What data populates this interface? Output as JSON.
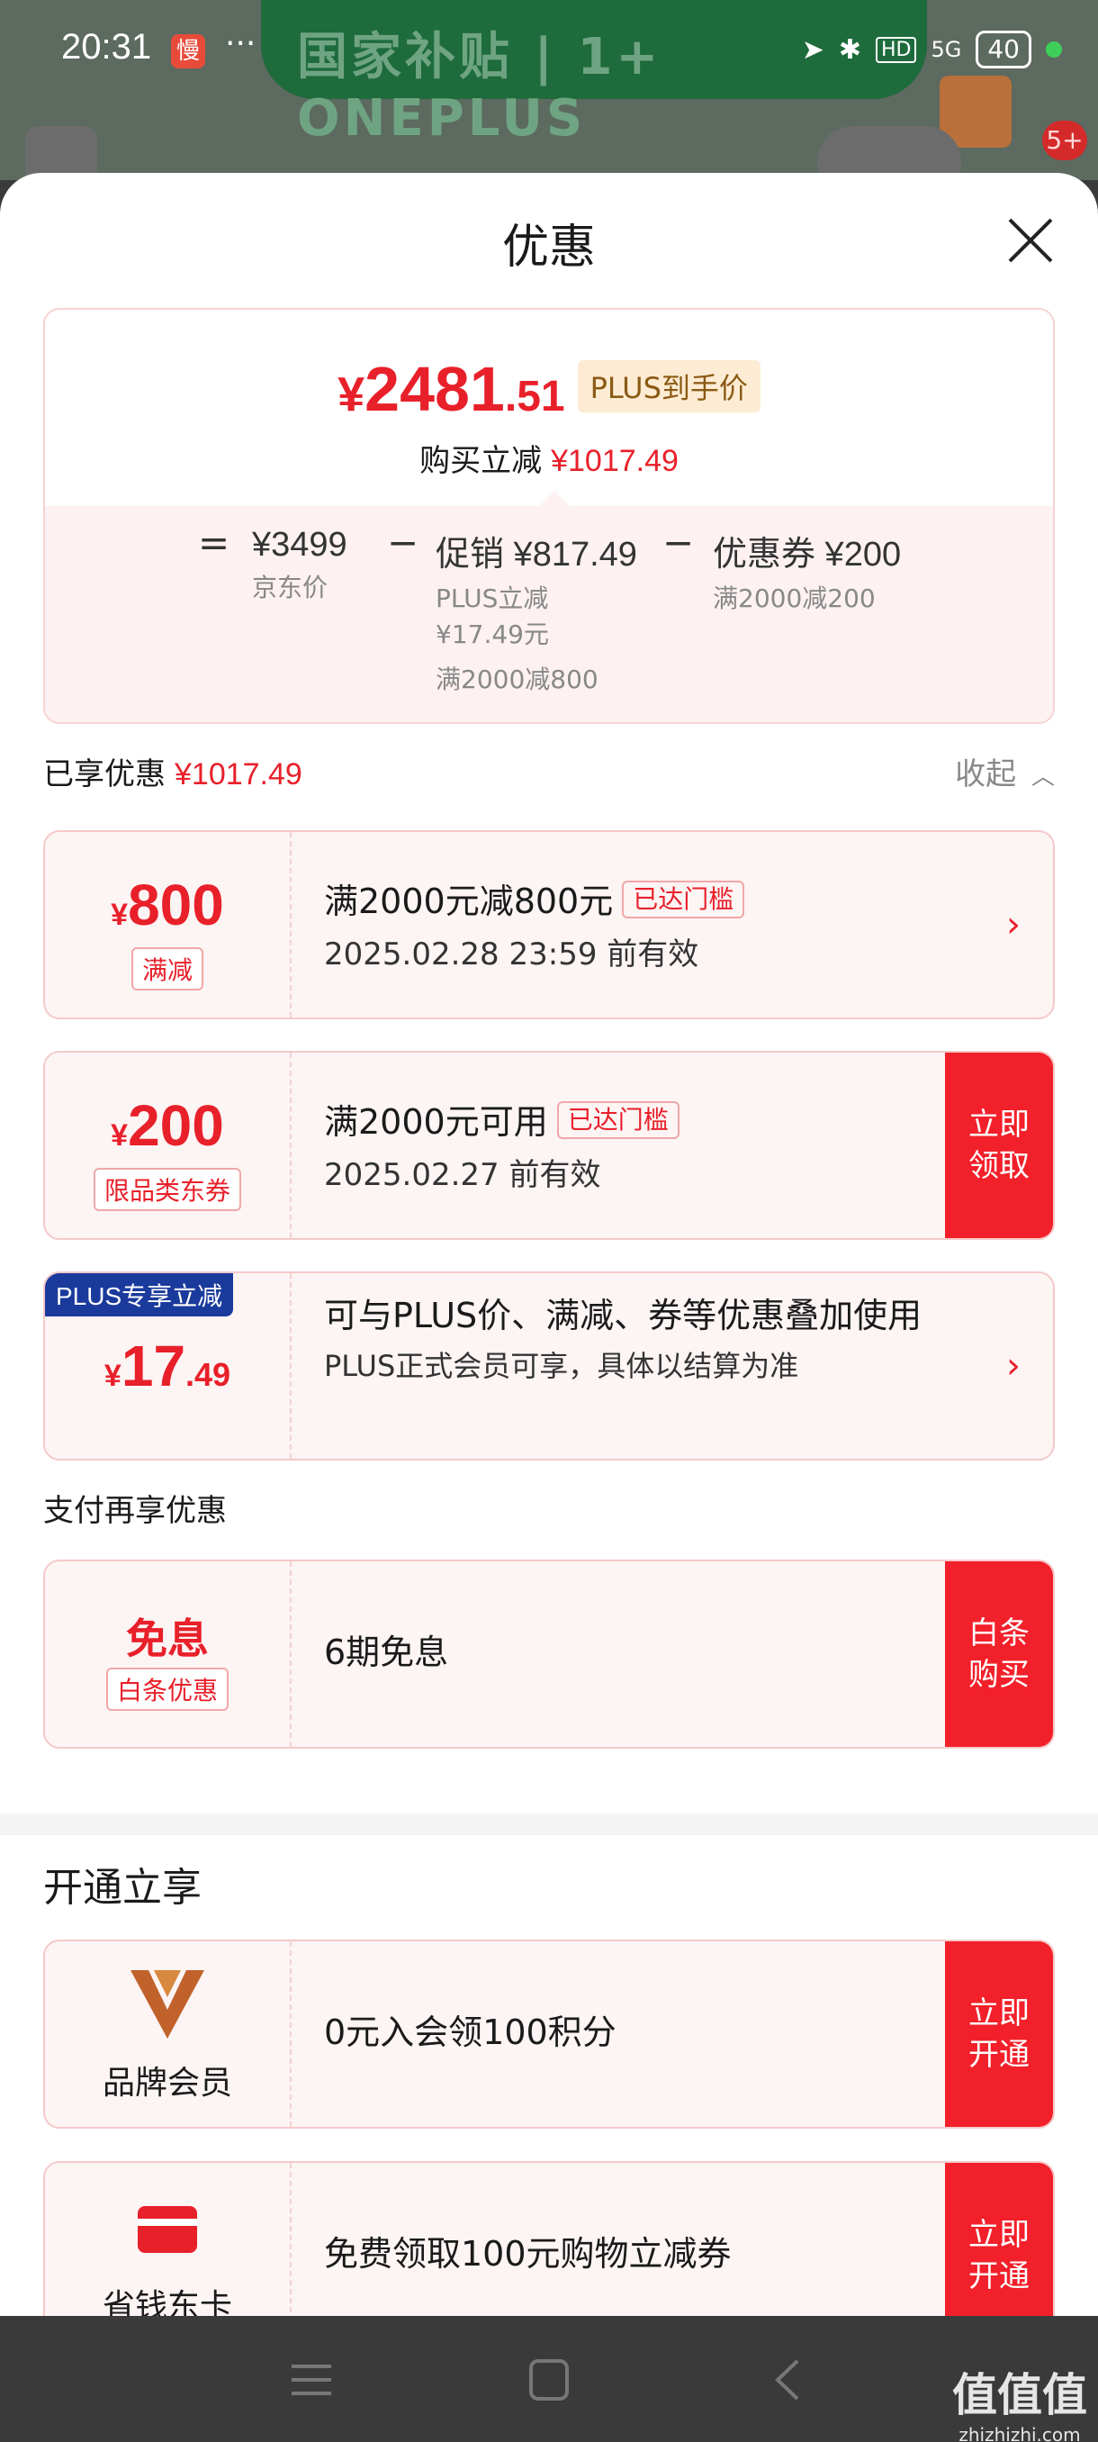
{
  "status_bar": {
    "time": "20:31",
    "app_badge": "慢",
    "dots": "···",
    "network": "5G",
    "hd": "HD",
    "battery": "40"
  },
  "background": {
    "banner_text": "国家补贴 | 1+ ONEPLUS",
    "notification_count": "5+"
  },
  "sheet": {
    "title": "优惠",
    "summary": {
      "price_symbol": "¥",
      "price_int": "2481",
      "price_dec": ".51",
      "plus_tag": "PLUS到手价",
      "reduce_label": "购买立减",
      "reduce_amount": "¥1017.49",
      "equals": "=",
      "minus": "−",
      "jd_price": "¥3499",
      "jd_price_label": "京东价",
      "promo": "促销 ¥817.49",
      "promo_sub1": "PLUS立减",
      "promo_sub2": "¥17.49元",
      "promo_sub3": "满2000减800",
      "coupon": "优惠券 ¥200",
      "coupon_sub": "满2000减200"
    },
    "enjoyed_label": "已享优惠",
    "enjoyed_amount": "¥1017.49",
    "collapse_label": "收起",
    "cards": [
      {
        "yen": "¥",
        "amount": "800",
        "tag": "满减",
        "title": "满2000元减800元",
        "threshold": "已达门槛",
        "subtitle": "2025.02.28 23:59 前有效"
      },
      {
        "yen": "¥",
        "amount": "200",
        "tag": "限品类东券",
        "title": "满2000元可用",
        "threshold": "已达门槛",
        "subtitle": "2025.02.27 前有效",
        "button": "立即\n领取"
      },
      {
        "ribbon": "PLUS专享立减",
        "yen": "¥",
        "amount": "17",
        "amount_dec": ".49",
        "title": "可与PLUS价、满减、券等优惠叠加使用",
        "subtitle": "PLUS正式会员可享，具体以结算为准"
      }
    ],
    "pay_section_label": "支付再享优惠",
    "pay_card": {
      "title": "免息",
      "tag": "白条优惠",
      "body": "6期免息",
      "button": "白条\n购买"
    },
    "open_section_title": "开通立享",
    "open_cards": [
      {
        "label": "品牌会员",
        "body": "0元入会领100积分",
        "button": "立即\n开通",
        "icon": "brand-member-icon",
        "icon_color": "#c0622a"
      },
      {
        "label": "省钱东卡",
        "body": "免费领取100元购物立减券",
        "button": "立即\n开通",
        "icon": "savings-card-icon",
        "icon_color": "#e8202a"
      }
    ]
  },
  "colors": {
    "accent_red": "#e8202a",
    "button_red": "#f2202a",
    "plus_blue": "#1a3a9c"
  },
  "watermark": {
    "main": "值值值",
    "sub": "zhizhizhi.com"
  }
}
